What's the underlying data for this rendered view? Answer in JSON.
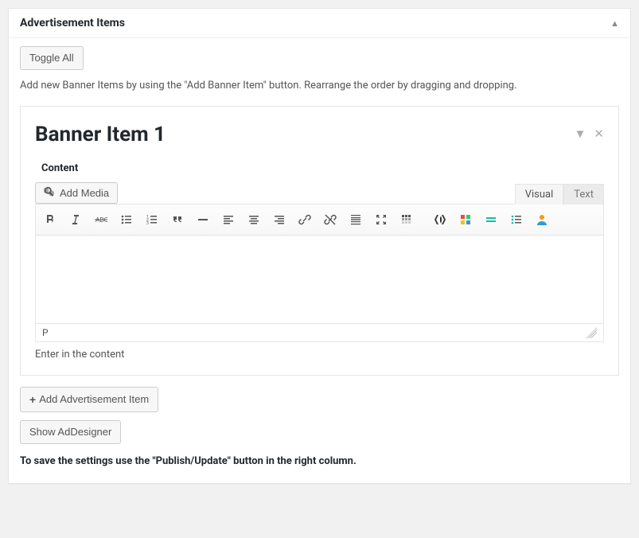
{
  "header": {
    "title": "Advertisement Items"
  },
  "buttons": {
    "toggle_all": "Toggle All",
    "add_media": "Add Media",
    "add_item": "Add Advertisement Item",
    "show_designer": "Show AdDesigner"
  },
  "help_text": "Add new Banner Items by using the \"Add Banner Item\" button. Rearrange the order by dragging and dropping.",
  "banner": {
    "title": "Banner Item 1",
    "content_label": "Content"
  },
  "editor": {
    "tabs": {
      "visual": "Visual",
      "text": "Text"
    },
    "status_path": "P",
    "hint": "Enter in the content"
  },
  "save_note": "To save the settings use the \"Publish/Update\" button in the right column."
}
